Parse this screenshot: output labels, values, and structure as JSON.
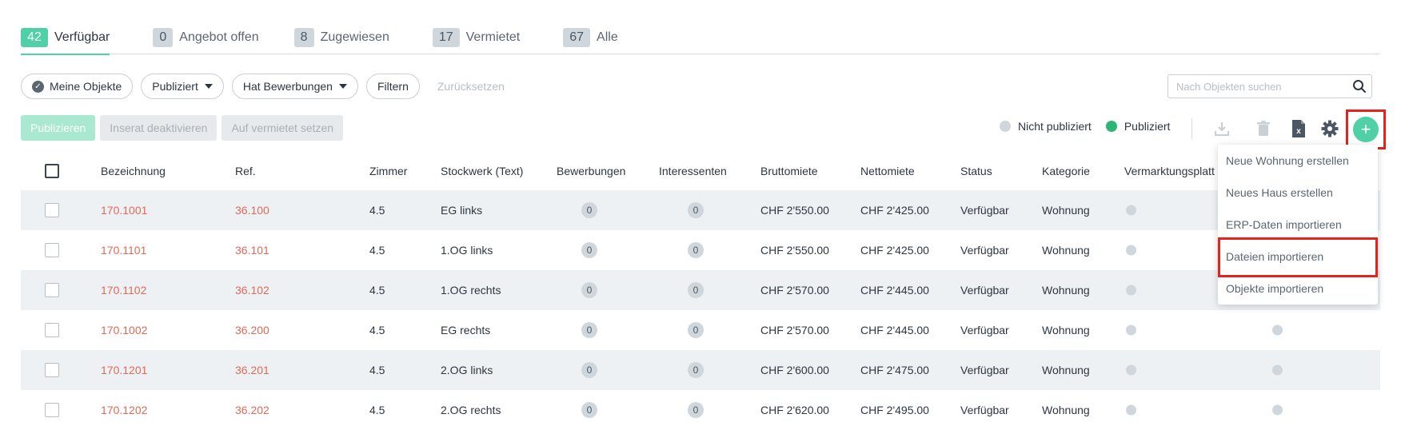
{
  "tabs": [
    {
      "count": "42",
      "label": "Verfügbar",
      "active": true
    },
    {
      "count": "0",
      "label": "Angebot offen"
    },
    {
      "count": "8",
      "label": "Zugewiesen"
    },
    {
      "count": "17",
      "label": "Vermietet"
    },
    {
      "count": "67",
      "label": "Alle"
    }
  ],
  "filters": {
    "my_objects": "Meine Objekte",
    "published": "Publiziert",
    "has_applications": "Hat Bewerbungen",
    "filter": "Filtern",
    "reset": "Zurücksetzen"
  },
  "search": {
    "placeholder": "Nach Objekten suchen",
    "value": ""
  },
  "actions": {
    "publish": "Publizieren",
    "deactivate": "Inserat deaktivieren",
    "set_rented": "Auf vermietet setzen"
  },
  "legend": {
    "not_published": "Nicht publiziert",
    "published": "Publiziert",
    "not_published_color": "#cfd6dc",
    "published_color": "#2bb673"
  },
  "toolbar_icons": [
    "download-icon",
    "trash-icon",
    "excel-file-icon",
    "gear-icon",
    "plus-icon"
  ],
  "table": {
    "columns": [
      "Bezeichnung",
      "Ref.",
      "Zimmer",
      "Stockwerk (Text)",
      "Bewerbungen",
      "Interessenten",
      "Bruttomiete",
      "Nettomiete",
      "Status",
      "Kategorie",
      "Vermarktungsplatt"
    ],
    "rows": [
      {
        "name": "170.1001",
        "ref": "36.100",
        "rooms": "4.5",
        "floor": "EG links",
        "applications": "0",
        "interested": "0",
        "gross": "CHF 2'550.00",
        "net": "CHF 2'425.00",
        "status": "Verfügbar",
        "category": "Wohnung"
      },
      {
        "name": "170.1101",
        "ref": "36.101",
        "rooms": "4.5",
        "floor": "1.OG links",
        "applications": "0",
        "interested": "0",
        "gross": "CHF 2'550.00",
        "net": "CHF 2'425.00",
        "status": "Verfügbar",
        "category": "Wohnung"
      },
      {
        "name": "170.1102",
        "ref": "36.102",
        "rooms": "4.5",
        "floor": "1.OG rechts",
        "applications": "0",
        "interested": "0",
        "gross": "CHF 2'570.00",
        "net": "CHF 2'445.00",
        "status": "Verfügbar",
        "category": "Wohnung"
      },
      {
        "name": "170.1002",
        "ref": "36.200",
        "rooms": "4.5",
        "floor": "EG rechts",
        "applications": "0",
        "interested": "0",
        "gross": "CHF 2'570.00",
        "net": "CHF 2'445.00",
        "status": "Verfügbar",
        "category": "Wohnung"
      },
      {
        "name": "170.1201",
        "ref": "36.201",
        "rooms": "4.5",
        "floor": "2.OG links",
        "applications": "0",
        "interested": "0",
        "gross": "CHF 2'600.00",
        "net": "CHF 2'475.00",
        "status": "Verfügbar",
        "category": "Wohnung"
      },
      {
        "name": "170.1202",
        "ref": "36.202",
        "rooms": "4.5",
        "floor": "2.OG rechts",
        "applications": "0",
        "interested": "0",
        "gross": "CHF 2'620.00",
        "net": "CHF 2'495.00",
        "status": "Verfügbar",
        "category": "Wohnung"
      }
    ]
  },
  "add_menu": {
    "items": [
      "Neue Wohnung erstellen",
      "Neues Haus erstellen",
      "ERP-Daten importieren",
      "Dateien importieren",
      "Objekte importieren"
    ]
  },
  "colors": {
    "accent": "#4fd1a5",
    "link": "#e06a56",
    "highlight": "#e5221c"
  }
}
